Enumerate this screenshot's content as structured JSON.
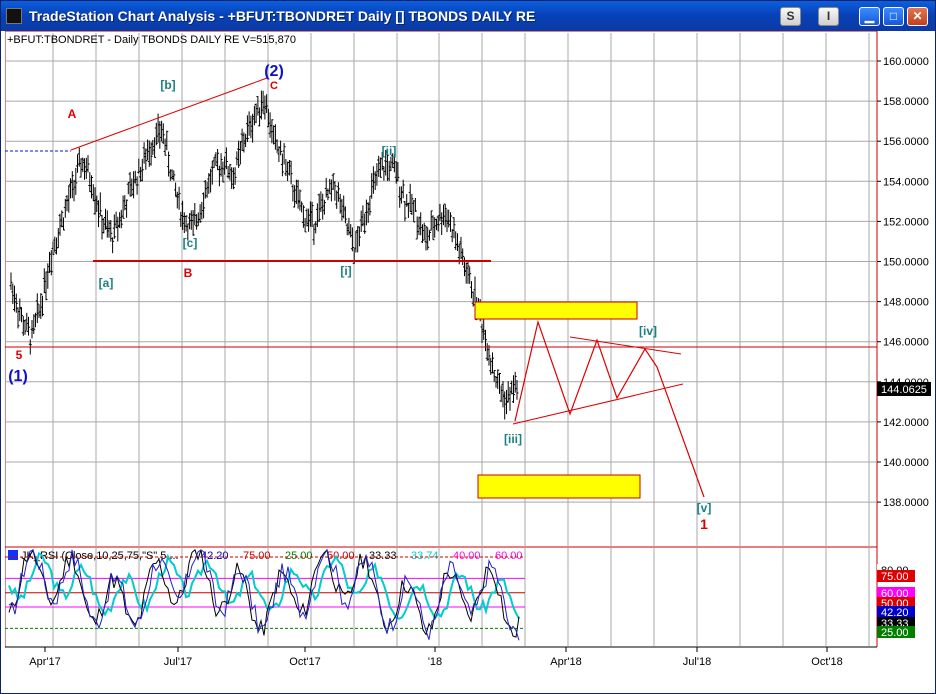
{
  "window": {
    "title": "TradeStation Chart Analysis - +BFUT:TBONDRET Daily [] TBONDS DAILY RE",
    "buttons": [
      "S",
      "I"
    ]
  },
  "price_panel": {
    "header": "+BFUT:TBONDRET - Daily  TBONDS DAILY RE  V=515,870",
    "last_price": "144.0625",
    "colors": {
      "bars": "#000000",
      "annotations_red": "#dd0000",
      "annotations_teal": "#1a8080",
      "wave_blue": "#1010cc",
      "box_fill": "#ffff00",
      "box_border": "#cc0000"
    }
  },
  "indicator_panel": {
    "header_name": "JK_RSI (Close,10,25,75,\"S\",5,...",
    "header_values": [
      "42.20",
      "75.00",
      "25.00",
      "50.00",
      "33.33",
      "33.74",
      "40.00",
      "60.00"
    ],
    "header_colors": [
      "#0000cc",
      "#cc0000",
      "#008000",
      "#cc0000",
      "#000000",
      "#00cccc",
      "#ff00ff",
      "#ff00ff"
    ],
    "axis_labels": [
      "80.00",
      "75.00",
      "60.00",
      "50.00",
      "42.20",
      "33.33",
      "25.00"
    ]
  },
  "chart_data": {
    "type": "ohlc",
    "title": "+BFUT:TBONDRET - Daily  TBONDS DAILY RE",
    "y_ticks": [
      "160.0000",
      "158.0000",
      "156.0000",
      "154.0000",
      "152.0000",
      "150.0000",
      "148.0000",
      "146.0000",
      "144.0000",
      "142.0000",
      "140.0000",
      "138.0000"
    ],
    "ylim": [
      137,
      161.3
    ],
    "x_ticks": [
      "Apr'17",
      "Jul'17",
      "Oct'17",
      "'18",
      "Apr'18",
      "Jul'18",
      "Oct'18"
    ],
    "closes_approx": [
      148.9,
      147.2,
      146.1,
      148.0,
      150.5,
      152.0,
      153.5,
      155.0,
      154.0,
      152.0,
      151.2,
      152.5,
      153.8,
      154.8,
      156.0,
      156.5,
      154.0,
      152.2,
      151.6,
      153.2,
      154.5,
      155.0,
      154.2,
      156.0,
      157.2,
      158.2,
      156.0,
      155.0,
      153.5,
      152.2,
      152.0,
      153.0,
      153.8,
      152.0,
      150.5,
      152.5,
      154.0,
      154.8,
      154.5,
      153.0,
      152.5,
      151.0,
      152.0,
      152.5,
      151.0,
      149.5,
      148.0,
      146.0,
      144.0,
      143.0,
      144.0
    ],
    "annotations": [
      {
        "text": "5",
        "color": "red"
      },
      {
        "text": "(1)",
        "color": "blue"
      },
      {
        "text": "A",
        "color": "red"
      },
      {
        "text": "[a]",
        "color": "teal"
      },
      {
        "text": "[b]",
        "color": "teal"
      },
      {
        "text": "[c]",
        "color": "teal"
      },
      {
        "text": "B",
        "color": "red"
      },
      {
        "text": "(2)",
        "color": "blue"
      },
      {
        "text": "C",
        "color": "red"
      },
      {
        "text": "[i]",
        "color": "teal"
      },
      {
        "text": "[ii]",
        "color": "teal"
      },
      {
        "text": "[iii]",
        "color": "teal"
      },
      {
        "text": "[iv]",
        "color": "teal"
      },
      {
        "text": "[v]",
        "color": "teal"
      },
      {
        "text": "1",
        "color": "red"
      }
    ],
    "projection_targets": [
      {
        "range": [
          147.5,
          148.0
        ]
      },
      {
        "range": [
          139.0,
          140.0
        ]
      }
    ],
    "rsi_levels": [
      75,
      60,
      50,
      40,
      33.33,
      25
    ]
  }
}
